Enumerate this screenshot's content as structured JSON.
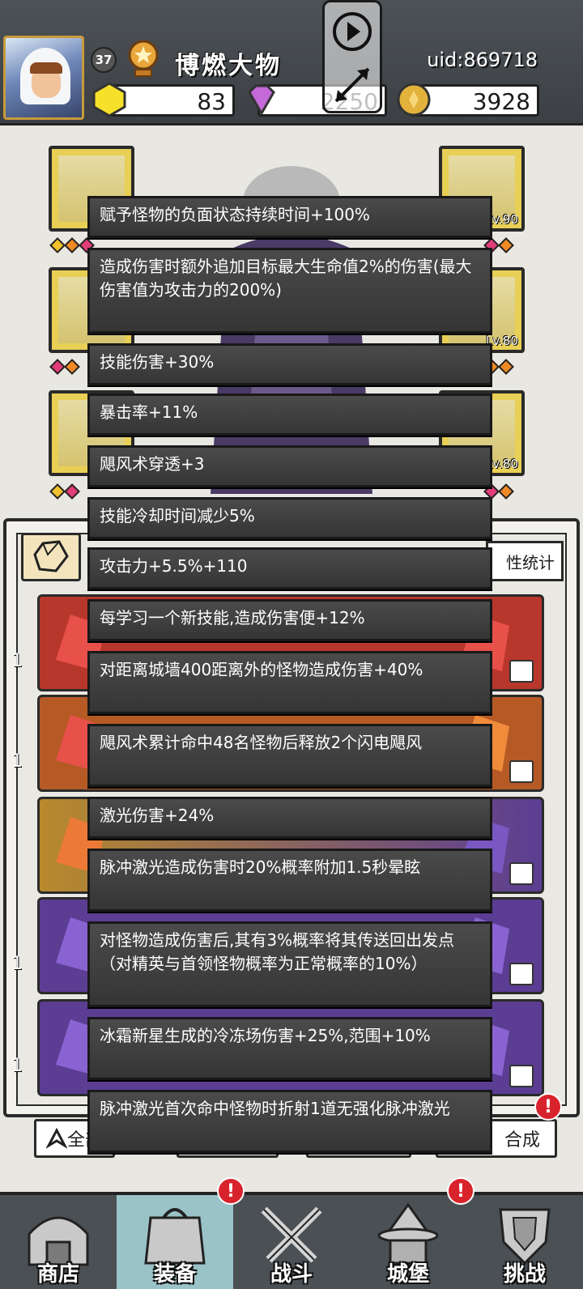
{
  "header": {
    "level": "37",
    "player_name": "博燃大物",
    "uid": "uid:869718",
    "resources": [
      {
        "name": "yellow-gem",
        "value": "83",
        "color": "#f6e02a"
      },
      {
        "name": "purple-diamond",
        "value": "2250",
        "color": "#c46ad8"
      },
      {
        "name": "gold-coin",
        "value": "3928",
        "color": "#e3b23a"
      }
    ]
  },
  "equipment": {
    "slots": [
      {
        "side": "left",
        "row": 1,
        "level": ""
      },
      {
        "side": "right",
        "row": 1,
        "level": "Lv.90"
      },
      {
        "side": "left",
        "row": 2,
        "level": ""
      },
      {
        "side": "right",
        "row": 2,
        "level": "Lv.80"
      },
      {
        "side": "left",
        "row": 3,
        "level": ""
      },
      {
        "side": "right",
        "row": 3,
        "level": "Lv.80"
      }
    ]
  },
  "panel": {
    "stats_tab_label": "性统计",
    "crystal_counts": [
      "1",
      "1",
      "1",
      "1",
      "1"
    ]
  },
  "effects": [
    "赋予怪物的负面状态持续时间+100%",
    "造成伤害时额外追加目标最大生命值2%的伤害(最大伤害值为攻击力的200%)",
    "技能伤害+30%",
    "暴击率+11%",
    "飓风术穿透+3",
    "技能冷却时间减少5%",
    "攻击力+5.5%+110",
    "每学习一个新技能,造成伤害便+12%",
    "对距离城墙400距离外的怪物造成伤害+40%",
    "飓风术累计命中48名怪物后释放2个闪电飓风",
    "激光伤害+24%",
    "脉冲激光造成伤害时20%概率附加1.5秒晕眩",
    "对怪物造成伤害后,其有3%概率将其传送回出发点（对精英与首领怪物概率为正常概率的10%）",
    "冰霜新星生成的冷冻场伤害+25%,范围+10%",
    "脉冲激光首次命中怪物时折射1道无强化脉冲激光"
  ],
  "actions": {
    "all_label": "全部",
    "synth_label": "合成",
    "alert_mark": "!"
  },
  "nav": [
    {
      "label": "商店",
      "icon": "shop-icon",
      "active": false,
      "alert": false
    },
    {
      "label": "装备",
      "icon": "equipment-bag-icon",
      "active": true,
      "alert": true
    },
    {
      "label": "战斗",
      "icon": "crossed-swords-icon",
      "active": false,
      "alert": false
    },
    {
      "label": "城堡",
      "icon": "castle-wizard-icon",
      "active": false,
      "alert": true
    },
    {
      "label": "挑战",
      "icon": "shield-challenge-icon",
      "active": false,
      "alert": false
    }
  ]
}
